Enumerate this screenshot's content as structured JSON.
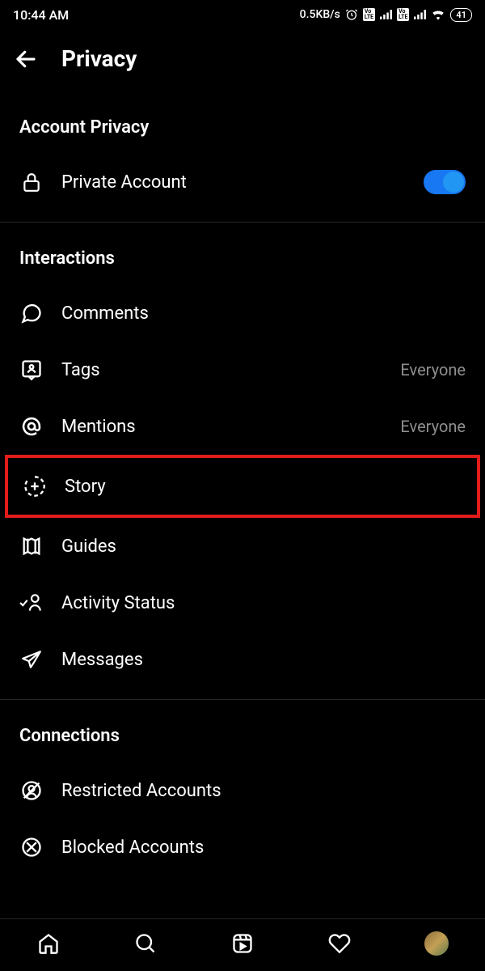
{
  "status": {
    "time": "10:44 AM",
    "data_rate": "0.5KB/s",
    "battery": "41"
  },
  "header": {
    "title": "Privacy"
  },
  "sections": {
    "account_privacy": {
      "title": "Account Privacy",
      "private_account_label": "Private Account"
    },
    "interactions": {
      "title": "Interactions",
      "comments": "Comments",
      "tags": "Tags",
      "tags_value": "Everyone",
      "mentions": "Mentions",
      "mentions_value": "Everyone",
      "story": "Story",
      "guides": "Guides",
      "activity_status": "Activity Status",
      "messages": "Messages"
    },
    "connections": {
      "title": "Connections",
      "restricted": "Restricted Accounts",
      "blocked": "Blocked Accounts"
    }
  }
}
